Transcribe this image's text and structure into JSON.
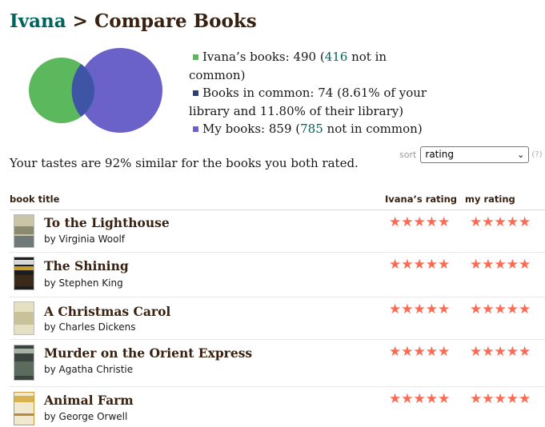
{
  "header": {
    "user": "Ivana",
    "separator": " > ",
    "page_title": "Compare Books"
  },
  "venn": {
    "their_color": "#5cb85c",
    "common_color": "#2c3e80",
    "mine_color": "#6a62c8"
  },
  "legend": {
    "their_label": "Ivana’s books: 490 (",
    "their_not_common_link": "416",
    "their_suffix": " not in common)",
    "common_text": "Books in common: 74 (8.61% of your library and 11.80% of their library)",
    "my_label": "My books: 859 (",
    "my_not_common_link": "785",
    "my_suffix": " not in common)"
  },
  "similarity_text": "Your tastes are 92% similar for the books you both rated.",
  "sort": {
    "label": "sort",
    "selected": "rating",
    "help": "(?)"
  },
  "table": {
    "col_title": "book title",
    "col_their_rating": "Ivana’s rating",
    "col_my_rating": "my rating",
    "star_glyphs": "★★★★★",
    "books": [
      {
        "title": "To the Lighthouse",
        "author": "by Virginia Woolf",
        "their_rating": 5,
        "my_rating": 5
      },
      {
        "title": "The Shining",
        "author": "by Stephen King",
        "their_rating": 5,
        "my_rating": 5
      },
      {
        "title": "A Christmas Carol",
        "author": "by Charles Dickens",
        "their_rating": 5,
        "my_rating": 5
      },
      {
        "title": "Murder on the Orient Express",
        "author": "by Agatha Christie",
        "their_rating": 5,
        "my_rating": 5
      },
      {
        "title": "Animal Farm",
        "author": "by George Orwell",
        "their_rating": 5,
        "my_rating": 5
      }
    ]
  }
}
